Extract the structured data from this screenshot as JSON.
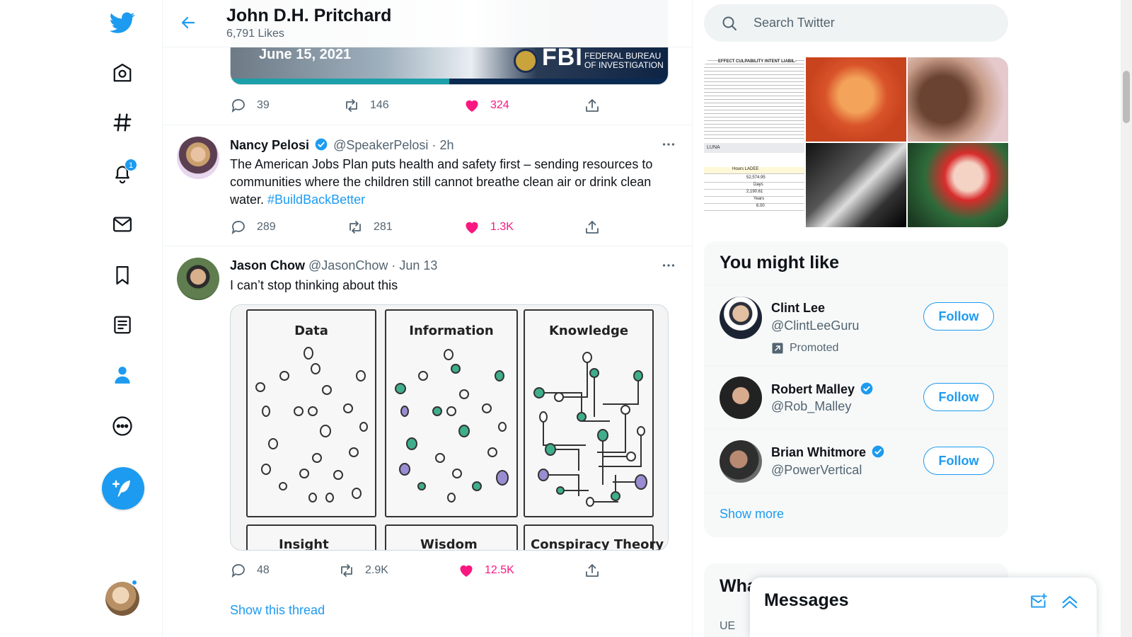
{
  "colors": {
    "accent": "#1d9bf0",
    "like": "#f91880",
    "text": "#0f1419",
    "secondary": "#536471"
  },
  "nav": {
    "items": [
      {
        "name": "twitter-logo-icon"
      },
      {
        "name": "home-icon"
      },
      {
        "name": "explore-hashtag-icon"
      },
      {
        "name": "notifications-bell-icon",
        "badge": "1"
      },
      {
        "name": "messages-envelope-icon"
      },
      {
        "name": "bookmarks-icon"
      },
      {
        "name": "lists-icon"
      },
      {
        "name": "profile-person-icon"
      },
      {
        "name": "more-circle-icon"
      }
    ]
  },
  "header": {
    "title": "John D.H. Pritchard",
    "subtitle": "6,791 Likes"
  },
  "tweets": [
    {
      "media_date": "June 15, 2021",
      "media_logo": "FBI",
      "media_org_line1": "FEDERAL BUREAU",
      "media_org_line2": "OF INVESTIGATION",
      "replies": "39",
      "retweets": "146",
      "likes": "324"
    },
    {
      "name": "Nancy Pelosi",
      "handle": "@SpeakerPelosi",
      "time": "2h",
      "text": "The American Jobs Plan puts health and safety first – sending resources to communities where the children still cannot breathe clean air or drink clean water. ",
      "hashtag": "#BuildBackBetter",
      "replies": "289",
      "retweets": "281",
      "likes": "1.3K"
    },
    {
      "name": "Jason Chow",
      "handle": "@JasonChow",
      "time": "Jun 13",
      "text": "I can’t stop thinking about this",
      "panels": [
        "Data",
        "Information",
        "Knowledge"
      ],
      "bottom_panels": [
        "Insight",
        "Wisdom",
        "Conspiracy Theory"
      ],
      "replies": "48",
      "retweets": "2.9K",
      "likes": "12.5K",
      "show_thread": "Show this thread"
    }
  ],
  "separator": "·",
  "search": {
    "placeholder": "Search Twitter"
  },
  "gallery": {
    "doc_heading": "EFFECT CULPABILITY INTENT LIABIL-",
    "sheet_name": "LUNA",
    "sheet_rows": [
      "Hours  LADEE",
      "52,574.95",
      "Days",
      "2,190.61",
      "Years",
      "6.00"
    ]
  },
  "who_to_follow": {
    "title": "You might like",
    "accounts": [
      {
        "name": "Clint Lee",
        "handle": "@ClintLeeGuru",
        "promoted": "Promoted",
        "verified": false,
        "button": "Follow"
      },
      {
        "name": "Robert Malley",
        "handle": "@Rob_Malley",
        "verified": true,
        "button": "Follow"
      },
      {
        "name": "Brian Whitmore",
        "handle": "@PowerVertical",
        "verified": true,
        "button": "Follow"
      }
    ],
    "show_more": "Show more"
  },
  "trends": {
    "title": "What’s happening",
    "peek_text": "UE"
  },
  "messages": {
    "title": "Messages"
  }
}
